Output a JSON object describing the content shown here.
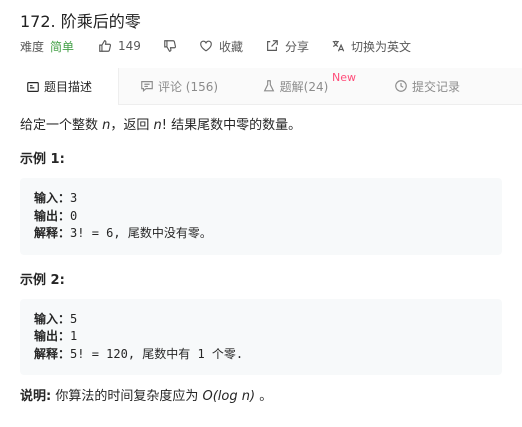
{
  "problem": {
    "title": "172. 阶乘后的零"
  },
  "meta": {
    "difficulty_label": "难度",
    "difficulty": "简单",
    "likes": "149",
    "favorite_label": "收藏",
    "share_label": "分享",
    "lang_label": "切换为英文"
  },
  "tabs": [
    {
      "label": "题目描述"
    },
    {
      "label": "评论 (156)"
    },
    {
      "label": "题解(24)",
      "badge": "New"
    },
    {
      "label": "提交记录"
    }
  ],
  "description": {
    "intro_pre": "给定一个整数 ",
    "intro_var": "n",
    "intro_mid": "，返回 ",
    "intro_var2": "n",
    "intro_post": "! 结果尾数中零的数量。"
  },
  "examples": [
    {
      "title": "示例 1:",
      "input_label": "输入：",
      "input": "3",
      "output_label": "输出：",
      "output": "0",
      "explain_label": "解释：",
      "explain": "3! = 6, 尾数中没有零。"
    },
    {
      "title": "示例 2:",
      "input_label": "输入：",
      "input": "5",
      "output_label": "输出：",
      "output": "1",
      "explain_label": "解释：",
      "explain": "5! = 120, 尾数中有 1 个零."
    }
  ],
  "note": {
    "label": "说明:",
    "text_pre": " 你算法的时间复杂度应为 ",
    "complexity_pre": "O(log ",
    "complexity_var": "n",
    "complexity_post": ")",
    "text_post": " 。"
  },
  "colors": {
    "easy": "#43a047",
    "badge": "#ff4d7a"
  }
}
